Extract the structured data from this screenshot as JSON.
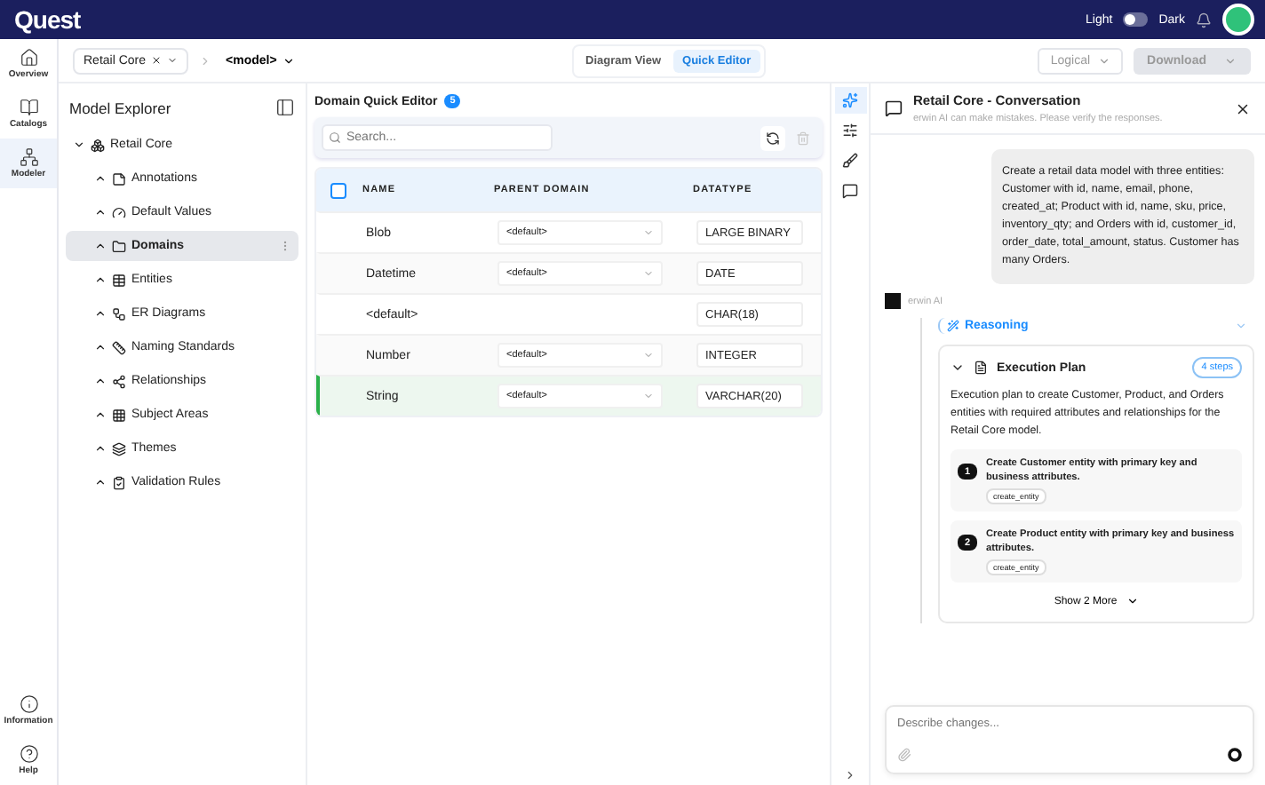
{
  "header": {
    "logo": "Quest",
    "theme_toggle": {
      "light_label": "Light",
      "dark_label": "Dark",
      "dark": false
    }
  },
  "nav": [
    {
      "label": "Overview",
      "selected": false
    },
    {
      "label": "Catalogs",
      "selected": false
    },
    {
      "label": "Modeler",
      "selected": true
    }
  ],
  "nav_bottom": [
    {
      "label": "Information"
    },
    {
      "label": "Help"
    }
  ],
  "toolbar": {
    "model_chip": "Retail Core",
    "model_select": "<model>",
    "views": [
      {
        "label": "Diagram View",
        "selected": false
      },
      {
        "label": "Quick Editor",
        "selected": true
      }
    ],
    "mode_select": "Logical",
    "download": "Download"
  },
  "explorer": {
    "title": "Model Explorer",
    "tree": [
      {
        "label": "Retail Core",
        "selected": false,
        "children": [
          {
            "label": "Annotations",
            "selected": false
          },
          {
            "label": "Default Values",
            "selected": false
          },
          {
            "label": "Domains",
            "selected": true
          },
          {
            "label": "Entities",
            "selected": false
          },
          {
            "label": "ER Diagrams",
            "selected": false
          },
          {
            "label": "Naming Standards",
            "selected": false
          },
          {
            "label": "Relationships",
            "selected": false
          },
          {
            "label": "Subject Areas",
            "selected": false
          },
          {
            "label": "Themes",
            "selected": false
          },
          {
            "label": "Validation Rules",
            "selected": false
          }
        ]
      }
    ]
  },
  "editor": {
    "title": "Domain Quick Editor",
    "count": "5",
    "search_placeholder": "Search...",
    "select_all": false,
    "columns": [
      "NAME",
      "PARENT DOMAIN",
      "DATATYPE"
    ],
    "rows": [
      {
        "name": "Blob",
        "parent": "<default>",
        "datatype": "LARGE BINARY",
        "selected": false
      },
      {
        "name": "Datetime",
        "parent": "<default>",
        "datatype": "DATE",
        "selected": false
      },
      {
        "name": "<default>",
        "datatype": "CHAR(18)",
        "selected": false
      },
      {
        "name": "Number",
        "parent": "<default>",
        "datatype": "INTEGER",
        "selected": false
      },
      {
        "name": "String",
        "parent": "<default>",
        "datatype": "VARCHAR(20)",
        "selected": true
      }
    ]
  },
  "tool_strip": [
    {
      "selected": true
    },
    {
      "selected": false
    },
    {
      "selected": false
    },
    {
      "selected": false
    }
  ],
  "chat": {
    "title": "Retail Core - Conversation",
    "subtitle": "erwin AI can make mistakes. Please verify the responses.",
    "user_message": "Create a retail data model with three entities: Customer with id, name, email, phone, created_at; Product with id, name, sku, price, inventory_qty; and Orders with id, customer_id, order_date, total_amount, status. Customer has many Orders.",
    "assistant": "erwin AI",
    "reasoning": "Reasoning",
    "plan": {
      "title": "Execution Plan",
      "badge": "4 steps",
      "expanded": true,
      "description": "Execution plan to create Customer, Product, and Orders entities with required attributes and relationships for the Retail Core model.",
      "steps": [
        {
          "number": "1",
          "title": "Create Customer entity with primary key and business attributes.",
          "tag": "create_entity"
        },
        {
          "number": "2",
          "title": "Create Product entity with primary key and business attributes.",
          "tag": "create_entity"
        }
      ],
      "more": "Show 2 More"
    },
    "input_placeholder": "Describe changes..."
  }
}
